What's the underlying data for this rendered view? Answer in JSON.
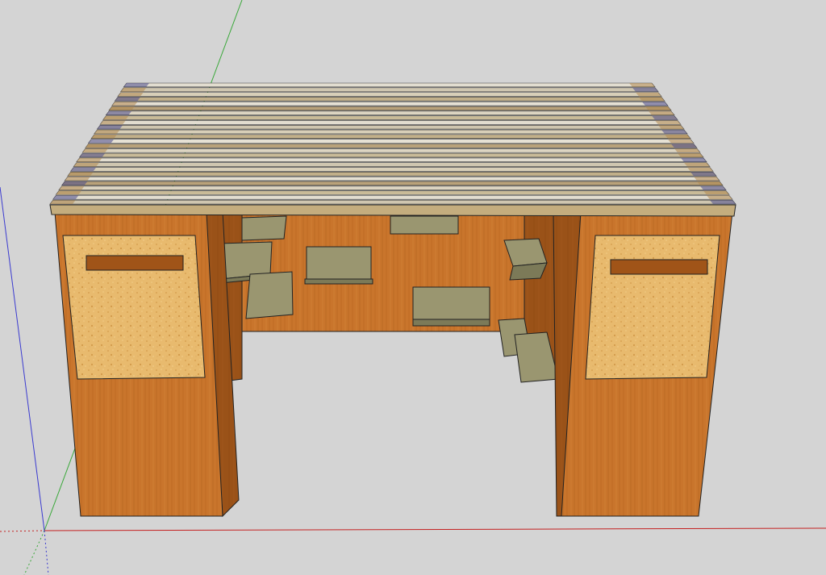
{
  "viewport": {
    "background": "#d4d4d4"
  },
  "colors": {
    "wood": "#c9752c",
    "wood_dark": "#a85a1c",
    "wood_side": "#8a4712",
    "cork": "#e8ba6e",
    "shelf": "#9a9670",
    "shelf_side": "#7c7a58",
    "slat_light": "#ddd7c8",
    "slat_dark": "#b89a6a",
    "axis_red": "#c42020",
    "axis_green": "#3aa83a",
    "axis_blue": "#3a3ad0"
  },
  "model": {
    "icons": [
      "x-axis-red",
      "y-axis-green",
      "z-axis-blue",
      "desk-model"
    ]
  }
}
